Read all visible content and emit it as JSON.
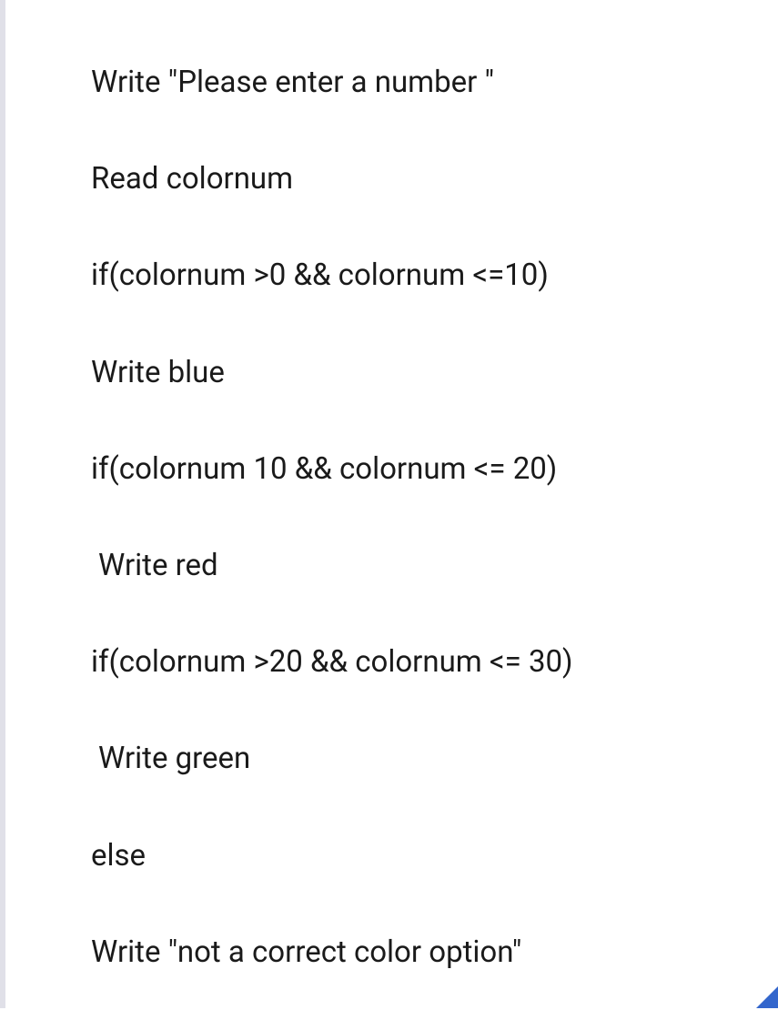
{
  "code": {
    "line1": "Write \"Please enter a number \"",
    "line2": "Read colornum",
    "line3": "if(colornum >0 && colornum <=10)",
    "line4": "Write blue",
    "line5": "if(colornum 10 && colornum <= 20)",
    "line6": "Write red",
    "line7": "if(colornum >20 && colornum <= 30)",
    "line8": "Write green",
    "line9": "else",
    "line10": "Write \"not a correct color option\""
  }
}
